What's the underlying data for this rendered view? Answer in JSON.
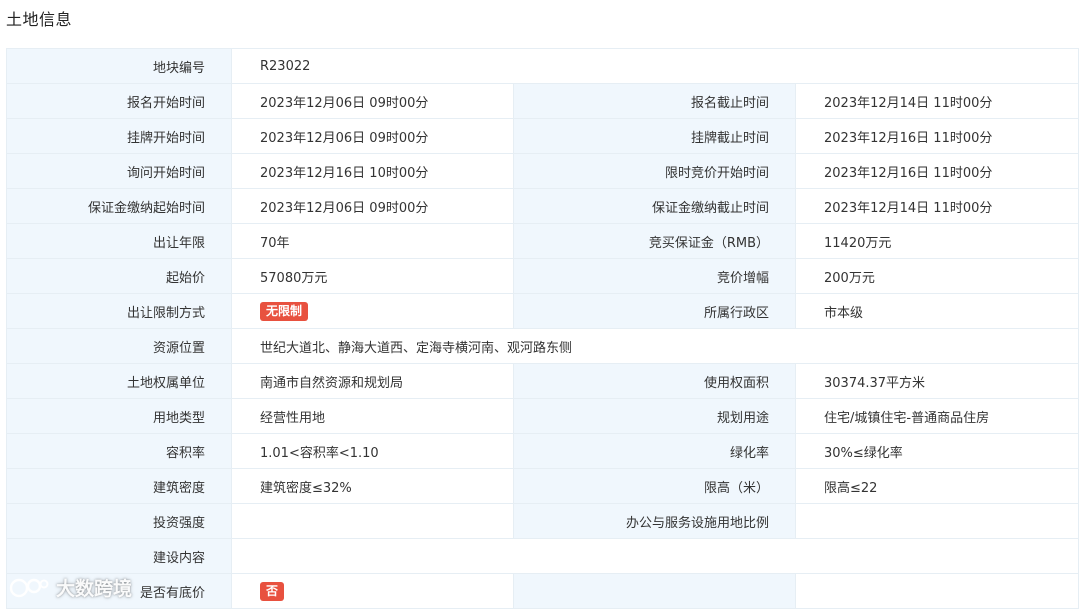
{
  "page": {
    "title": "土地信息"
  },
  "rows": [
    {
      "label": "地块编号",
      "value": "R23022"
    },
    {
      "label": "报名开始时间",
      "value": "2023年12月06日 09时00分",
      "label2": "报名截止时间",
      "value2": "2023年12月14日 11时00分"
    },
    {
      "label": "挂牌开始时间",
      "value": "2023年12月06日 09时00分",
      "label2": "挂牌截止时间",
      "value2": "2023年12月16日 11时00分"
    },
    {
      "label": "询问开始时间",
      "value": "2023年12月16日 10时00分",
      "label2": "限时竞价开始时间",
      "value2": "2023年12月16日 11时00分"
    },
    {
      "label": "保证金缴纳起始时间",
      "value": "2023年12月06日 09时00分",
      "label2": "保证金缴纳截止时间",
      "value2": "2023年12月14日 11时00分"
    },
    {
      "label": "出让年限",
      "value": "70年",
      "label2": "竞买保证金（RMB）",
      "value2": "11420万元"
    },
    {
      "label": "起始价",
      "value": "57080万元",
      "label2": "竞价增幅",
      "value2": "200万元"
    },
    {
      "label": "出让限制方式",
      "badge": "无限制",
      "label2": "所属行政区",
      "value2": "市本级"
    },
    {
      "label": "资源位置",
      "value": "世纪大道北、静海大道西、定海寺横河南、观河路东侧"
    },
    {
      "label": "土地权属单位",
      "value": "南通市自然资源和规划局",
      "label2": "使用权面积",
      "value2": "30374.37平方米"
    },
    {
      "label": "用地类型",
      "value": "经营性用地",
      "label2": "规划用途",
      "value2": "住宅/城镇住宅-普通商品住房"
    },
    {
      "label": "容积率",
      "value": "1.01<容积率<1.10",
      "label2": "绿化率",
      "value2": "30%≤绿化率"
    },
    {
      "label": "建筑密度",
      "value": "建筑密度≤32%",
      "label2": "限高（米）",
      "value2": "限高≤22"
    },
    {
      "label": "投资强度",
      "value": "",
      "label2": "办公与服务设施用地比例",
      "value2": ""
    },
    {
      "label": "建设内容",
      "value": ""
    },
    {
      "label": "是否有底价",
      "badge": "否",
      "label2": "",
      "value2": ""
    }
  ],
  "watermark": {
    "text": "大数跨境",
    "icon": "brand-logo-icon"
  },
  "colors": {
    "label_bg": "#f0f7fd",
    "border": "#e6eef4",
    "badge_bg": "#e8513f"
  }
}
